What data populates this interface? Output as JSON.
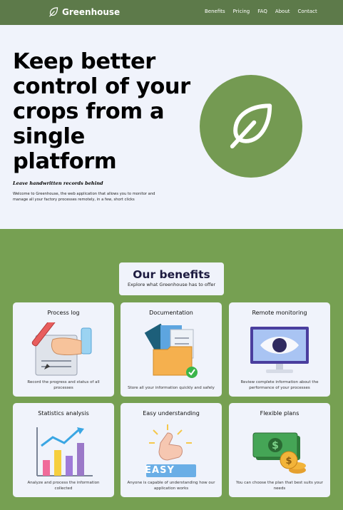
{
  "brand": {
    "name": "Greenhouse",
    "icon": "leaf-icon"
  },
  "nav": {
    "links": [
      "Benefits",
      "Pricing",
      "FAQ",
      "About",
      "Contact"
    ]
  },
  "hero": {
    "title": "Keep better control of your crops from a single platform",
    "subtitle": "Leave handwritten records behind",
    "description": "Welcome to Greenhouse, the web application that allows you to monitor and manage all your factory processes remotely, in a few, short clicks",
    "icon": "leaf-icon"
  },
  "benefits": {
    "title": "Our benefits",
    "tagline": "Explore what Greenhouse has to offer",
    "cards": [
      {
        "title": "Process log",
        "description": "Record the progress and status of all processes",
        "icon": "hand-writing-icon"
      },
      {
        "title": "Documentation",
        "description": "Store all your information quickly and safely",
        "icon": "documents-folder-icon"
      },
      {
        "title": "Remote monitoring",
        "description": "Review complete information about the performance of your processes",
        "icon": "eye-monitor-icon"
      },
      {
        "title": "Statistics analysis",
        "description": "Analyze and process the information collected",
        "icon": "bar-chart-icon"
      },
      {
        "title": "Easy understanding",
        "description": "Anyone is capable of understanding how our application works",
        "icon": "easy-pointer-icon",
        "badge": "EASY"
      },
      {
        "title": "Flexible plans",
        "description": "You can choose the plan that best suits your needs",
        "icon": "money-coins-icon"
      }
    ]
  },
  "colors": {
    "nav": "#5d7a4a",
    "hero_circle": "#749a52",
    "benefits_bg": "#76a052",
    "card_bg": "#f0f3fb",
    "heading_dark": "#1d1b40"
  }
}
